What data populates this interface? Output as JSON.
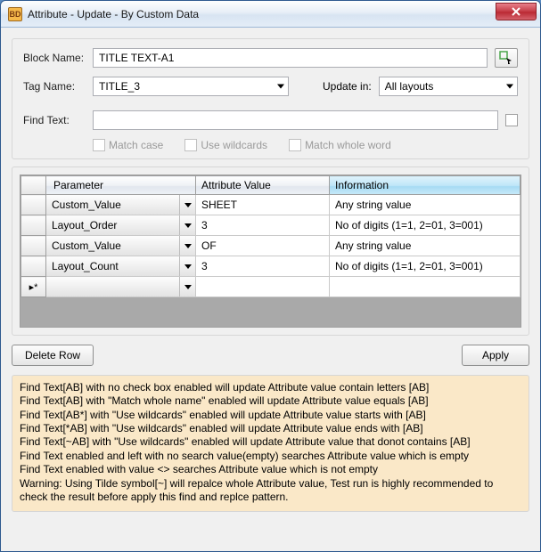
{
  "window": {
    "icon_label": "BD",
    "title": "Attribute - Update - By Custom Data"
  },
  "form": {
    "block_name_label": "Block Name:",
    "block_name_value": "TITLE TEXT-A1",
    "tag_name_label": "Tag Name:",
    "tag_name_value": "TITLE_3",
    "update_in_label": "Update in:",
    "update_in_value": "All layouts",
    "find_text_label": "Find Text:",
    "find_text_value": "",
    "match_case_label": "Match case",
    "use_wildcards_label": "Use wildcards",
    "match_whole_word_label": "Match whole word"
  },
  "grid": {
    "headers": {
      "parameter": "Parameter",
      "attribute_value": "Attribute Value",
      "information": "Information"
    },
    "rows": [
      {
        "parameter": "Custom_Value",
        "value": "SHEET",
        "info": "Any string value"
      },
      {
        "parameter": "Layout_Order",
        "value": "3",
        "info": "No of digits (1=1, 2=01, 3=001)"
      },
      {
        "parameter": "Custom_Value",
        "value": "OF",
        "info": "Any string value"
      },
      {
        "parameter": "Layout_Count",
        "value": "3",
        "info": "No of digits (1=1, 2=01, 3=001)"
      }
    ],
    "new_row_marker": "*"
  },
  "buttons": {
    "delete_row": "Delete Row",
    "apply": "Apply"
  },
  "help": {
    "l1": "Find Text[AB] with no check box enabled will update Attribute value contain letters [AB]",
    "l2": "Find Text[AB] with \"Match whole name\" enabled will update Attribute value equals [AB]",
    "l3": "Find Text[AB*] with \"Use wildcards\" enabled will update Attribute value starts with [AB]",
    "l4": "Find Text[*AB] with \"Use wildcards\" enabled will update Attribute value ends with [AB]",
    "l5": "Find Text[~AB] with \"Use wildcards\" enabled will update Attribute value that donot contains [AB]",
    "l6": "Find Text enabled and  left with no search value(empty) searches Attribute value which is empty",
    "l7": "Find Text enabled with value <> searches Attribute value which is not empty",
    "l8": "Warning: Using Tilde symbol[~] will repalce whole Attribute value, Test run is highly recommended to check the result before apply this find and replce pattern."
  }
}
